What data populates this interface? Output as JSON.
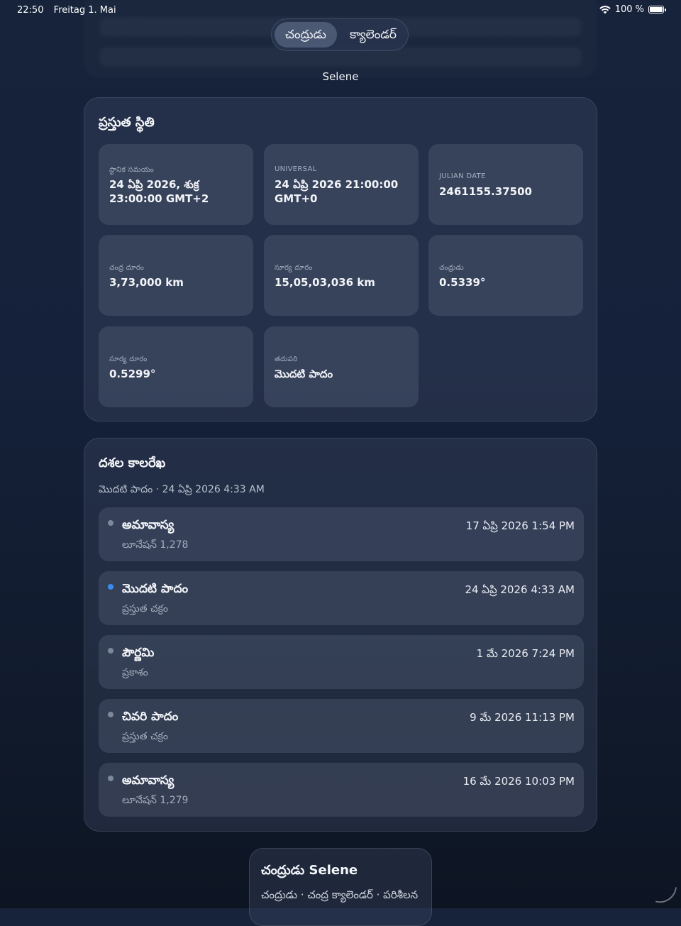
{
  "status_bar": {
    "time": "22:50",
    "date": "Freitag 1. Mai",
    "battery": "100 %"
  },
  "segmented": {
    "active": "చంద్రుడు",
    "other": "క్యాలెండర్"
  },
  "app_name": "Selene",
  "current_state": {
    "title": "ప్రస్తుత స్థితి",
    "tiles": [
      {
        "label": "స్థానిక సమయం",
        "value": "24 ఏప్రి 2026, శుక్ర 23:00:00 GMT+2"
      },
      {
        "label": "UNIVERSAL",
        "value": "24 ఏప్రి 2026 21:00:00 GMT+0"
      },
      {
        "label": "JULIAN DATE",
        "value": "2461155.37500"
      },
      {
        "label": "చంద్ర దూరం",
        "value": "3,73,000 km"
      },
      {
        "label": "సూర్య దూరం",
        "value": "15,05,03,036 km"
      },
      {
        "label": "చంద్రుడు",
        "value": "0.5339°"
      },
      {
        "label": "సూర్య దూరం",
        "value": "0.5299°"
      },
      {
        "label": "తదుపరి",
        "value": "మొదటి పాదం"
      }
    ]
  },
  "timeline": {
    "title": "దశల కాలరేఖ",
    "subtitle": "మొదటి పాదం · 24 ఏప్రి 2026 4:33 AM",
    "items": [
      {
        "name": "అమావాస్య",
        "sub": "లూనేషన్ 1,278",
        "date": "17 ఏప్రి 2026 1:54 PM",
        "active": false
      },
      {
        "name": "మొదటి పాదం",
        "sub": "ప్రస్తుత చక్రం",
        "date": "24 ఏప్రి 2026 4:33 AM",
        "active": true
      },
      {
        "name": "పౌర్ణమి",
        "sub": "ప్రకాశం",
        "date": "1 మే 2026 7:24 PM",
        "active": false
      },
      {
        "name": "చివరి పాదం",
        "sub": "ప్రస్తుత చక్రం",
        "date": "9 మే 2026 11:13 PM",
        "active": false
      },
      {
        "name": "అమావాస్య",
        "sub": "లూనేషన్ 1,279",
        "date": "16 మే 2026 10:03 PM",
        "active": false
      }
    ]
  },
  "footer": {
    "title": "చంద్రుడు Selene",
    "subtitle": "చంద్రుడు · చంద్ర క్యాలెండర్ · పరిశీలన"
  },
  "colors": {
    "accent_dot": "#3b8cf0",
    "inactive_dot": "#7e889b",
    "background": "#15213a"
  }
}
